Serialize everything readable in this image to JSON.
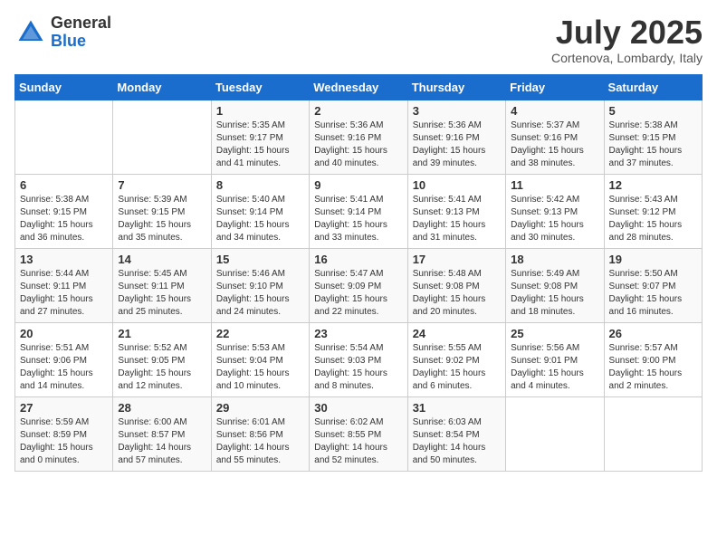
{
  "header": {
    "logo_general": "General",
    "logo_blue": "Blue",
    "month_title": "July 2025",
    "location": "Cortenova, Lombardy, Italy"
  },
  "weekdays": [
    "Sunday",
    "Monday",
    "Tuesday",
    "Wednesday",
    "Thursday",
    "Friday",
    "Saturday"
  ],
  "weeks": [
    [
      {
        "day": "",
        "info": ""
      },
      {
        "day": "",
        "info": ""
      },
      {
        "day": "1",
        "info": "Sunrise: 5:35 AM\nSunset: 9:17 PM\nDaylight: 15 hours\nand 41 minutes."
      },
      {
        "day": "2",
        "info": "Sunrise: 5:36 AM\nSunset: 9:16 PM\nDaylight: 15 hours\nand 40 minutes."
      },
      {
        "day": "3",
        "info": "Sunrise: 5:36 AM\nSunset: 9:16 PM\nDaylight: 15 hours\nand 39 minutes."
      },
      {
        "day": "4",
        "info": "Sunrise: 5:37 AM\nSunset: 9:16 PM\nDaylight: 15 hours\nand 38 minutes."
      },
      {
        "day": "5",
        "info": "Sunrise: 5:38 AM\nSunset: 9:15 PM\nDaylight: 15 hours\nand 37 minutes."
      }
    ],
    [
      {
        "day": "6",
        "info": "Sunrise: 5:38 AM\nSunset: 9:15 PM\nDaylight: 15 hours\nand 36 minutes."
      },
      {
        "day": "7",
        "info": "Sunrise: 5:39 AM\nSunset: 9:15 PM\nDaylight: 15 hours\nand 35 minutes."
      },
      {
        "day": "8",
        "info": "Sunrise: 5:40 AM\nSunset: 9:14 PM\nDaylight: 15 hours\nand 34 minutes."
      },
      {
        "day": "9",
        "info": "Sunrise: 5:41 AM\nSunset: 9:14 PM\nDaylight: 15 hours\nand 33 minutes."
      },
      {
        "day": "10",
        "info": "Sunrise: 5:41 AM\nSunset: 9:13 PM\nDaylight: 15 hours\nand 31 minutes."
      },
      {
        "day": "11",
        "info": "Sunrise: 5:42 AM\nSunset: 9:13 PM\nDaylight: 15 hours\nand 30 minutes."
      },
      {
        "day": "12",
        "info": "Sunrise: 5:43 AM\nSunset: 9:12 PM\nDaylight: 15 hours\nand 28 minutes."
      }
    ],
    [
      {
        "day": "13",
        "info": "Sunrise: 5:44 AM\nSunset: 9:11 PM\nDaylight: 15 hours\nand 27 minutes."
      },
      {
        "day": "14",
        "info": "Sunrise: 5:45 AM\nSunset: 9:11 PM\nDaylight: 15 hours\nand 25 minutes."
      },
      {
        "day": "15",
        "info": "Sunrise: 5:46 AM\nSunset: 9:10 PM\nDaylight: 15 hours\nand 24 minutes."
      },
      {
        "day": "16",
        "info": "Sunrise: 5:47 AM\nSunset: 9:09 PM\nDaylight: 15 hours\nand 22 minutes."
      },
      {
        "day": "17",
        "info": "Sunrise: 5:48 AM\nSunset: 9:08 PM\nDaylight: 15 hours\nand 20 minutes."
      },
      {
        "day": "18",
        "info": "Sunrise: 5:49 AM\nSunset: 9:08 PM\nDaylight: 15 hours\nand 18 minutes."
      },
      {
        "day": "19",
        "info": "Sunrise: 5:50 AM\nSunset: 9:07 PM\nDaylight: 15 hours\nand 16 minutes."
      }
    ],
    [
      {
        "day": "20",
        "info": "Sunrise: 5:51 AM\nSunset: 9:06 PM\nDaylight: 15 hours\nand 14 minutes."
      },
      {
        "day": "21",
        "info": "Sunrise: 5:52 AM\nSunset: 9:05 PM\nDaylight: 15 hours\nand 12 minutes."
      },
      {
        "day": "22",
        "info": "Sunrise: 5:53 AM\nSunset: 9:04 PM\nDaylight: 15 hours\nand 10 minutes."
      },
      {
        "day": "23",
        "info": "Sunrise: 5:54 AM\nSunset: 9:03 PM\nDaylight: 15 hours\nand 8 minutes."
      },
      {
        "day": "24",
        "info": "Sunrise: 5:55 AM\nSunset: 9:02 PM\nDaylight: 15 hours\nand 6 minutes."
      },
      {
        "day": "25",
        "info": "Sunrise: 5:56 AM\nSunset: 9:01 PM\nDaylight: 15 hours\nand 4 minutes."
      },
      {
        "day": "26",
        "info": "Sunrise: 5:57 AM\nSunset: 9:00 PM\nDaylight: 15 hours\nand 2 minutes."
      }
    ],
    [
      {
        "day": "27",
        "info": "Sunrise: 5:59 AM\nSunset: 8:59 PM\nDaylight: 15 hours\nand 0 minutes."
      },
      {
        "day": "28",
        "info": "Sunrise: 6:00 AM\nSunset: 8:57 PM\nDaylight: 14 hours\nand 57 minutes."
      },
      {
        "day": "29",
        "info": "Sunrise: 6:01 AM\nSunset: 8:56 PM\nDaylight: 14 hours\nand 55 minutes."
      },
      {
        "day": "30",
        "info": "Sunrise: 6:02 AM\nSunset: 8:55 PM\nDaylight: 14 hours\nand 52 minutes."
      },
      {
        "day": "31",
        "info": "Sunrise: 6:03 AM\nSunset: 8:54 PM\nDaylight: 14 hours\nand 50 minutes."
      },
      {
        "day": "",
        "info": ""
      },
      {
        "day": "",
        "info": ""
      }
    ]
  ]
}
